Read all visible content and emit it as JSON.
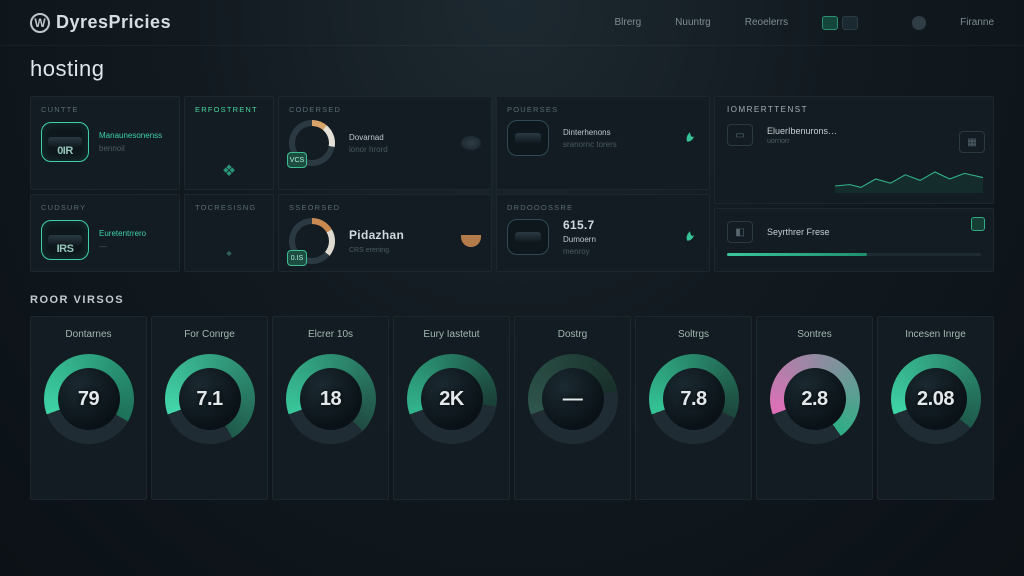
{
  "brand": {
    "logo_letter": "W",
    "name": "DyresPricies"
  },
  "nav": {
    "items": [
      "Blrerg",
      "Nuuntrg",
      "Reoelerrs",
      "Firanne"
    ]
  },
  "page_title": "hosting",
  "grid": {
    "c0": {
      "label": "CUNTTE",
      "value": "0IR",
      "line1": "Manaunesonenss",
      "line2": "bennoil"
    },
    "c1": {
      "label": "ERFOSTRENT",
      "glyph": "❖"
    },
    "c2": {
      "label": "CODERSED",
      "badge": "VCS",
      "line1": "Dovarnad",
      "line2": "lonor  hrord"
    },
    "c3": {
      "label": "POUERSES",
      "line1": "Dinterhenons",
      "line2": "sranornc  torers"
    },
    "c4": {
      "label": "CUDSURY",
      "value": "IRS",
      "line1": "Euretentrrero",
      "line2": "—"
    },
    "c5": {
      "label": "TOCRESISNG",
      "glyph": "⬩"
    },
    "c6": {
      "label": "SSEORSED",
      "badge": "0.IS",
      "price": "Pidazhan",
      "price_sub": "CRS  erening"
    },
    "c7": {
      "label": "DRDOOOSSRE",
      "price": "615.7",
      "line1": "Dumoern",
      "line2": "menroy"
    }
  },
  "right": {
    "p1": {
      "title": "IOmrerttenst",
      "line1": "EluerIbenurons…",
      "line2": "uorriorr"
    },
    "p2": {
      "title": "",
      "line1": "Seyrthrer Frese",
      "line2": ""
    }
  },
  "section2_title": "ROOR  VIRSOS",
  "gauges": [
    {
      "title": "Dontarnes",
      "value": "79",
      "color1": "#3ed3a4",
      "color2": "#1d6f58",
      "deg": 230
    },
    {
      "title": "For Conrge",
      "value": "7.1",
      "color1": "#43d7aa",
      "color2": "#1f5a4b",
      "deg": 260
    },
    {
      "title": "Elcrer 10s",
      "value": "18",
      "color1": "#39c79a",
      "color2": "#204b42",
      "deg": 245
    },
    {
      "title": "Eury Iastetut",
      "value": "2K",
      "color1": "#32b58c",
      "color2": "#1a3e36",
      "deg": 210
    },
    {
      "title": "Dostrg",
      "value": "—",
      "color1": "#2e564c",
      "color2": "#18302a",
      "deg": 190
    },
    {
      "title": "Soltrgs",
      "value": "7.8",
      "color1": "#34c496",
      "color2": "#1c463b",
      "deg": 225
    },
    {
      "title": "Sontres",
      "value": "2.8",
      "color1": "#e06fb8",
      "color2": "#2fae85",
      "deg": 255
    },
    {
      "title": "Incesen Inrge",
      "value": "2.08",
      "color1": "#3fd4a5",
      "color2": "#1e5a4b",
      "deg": 240
    }
  ]
}
